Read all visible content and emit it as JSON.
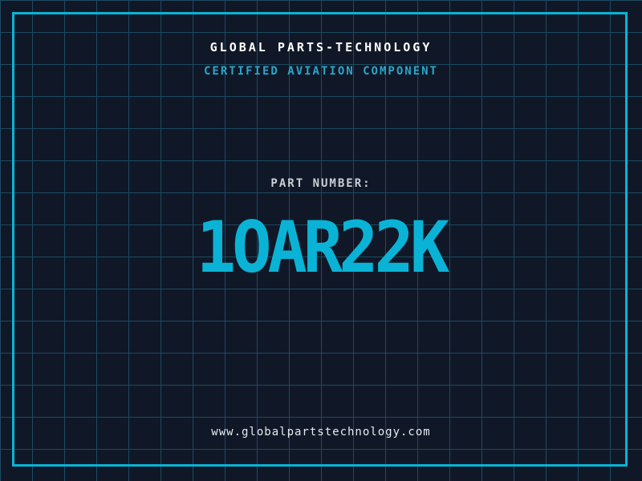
{
  "header": {
    "company": "GLOBAL PARTS-TECHNOLOGY",
    "subtitle": "CERTIFIED AVIATION COMPONENT"
  },
  "part": {
    "label": "PART NUMBER:",
    "number": "1OAR22K"
  },
  "footer": {
    "website": "www.globalpartstechnology.com"
  },
  "colors": {
    "background": "#101827",
    "grid_line": "#1c4a61",
    "border_cyan": "#0ab3d6",
    "part_number_cyan": "#0ab3d6",
    "subtitle_cyan": "#2ba5c9",
    "header_white": "#ffffff",
    "label_gray": "#c9ced6",
    "website_gray": "#e6eaee"
  },
  "layout_meta": {
    "grid_cell_px": "40"
  }
}
